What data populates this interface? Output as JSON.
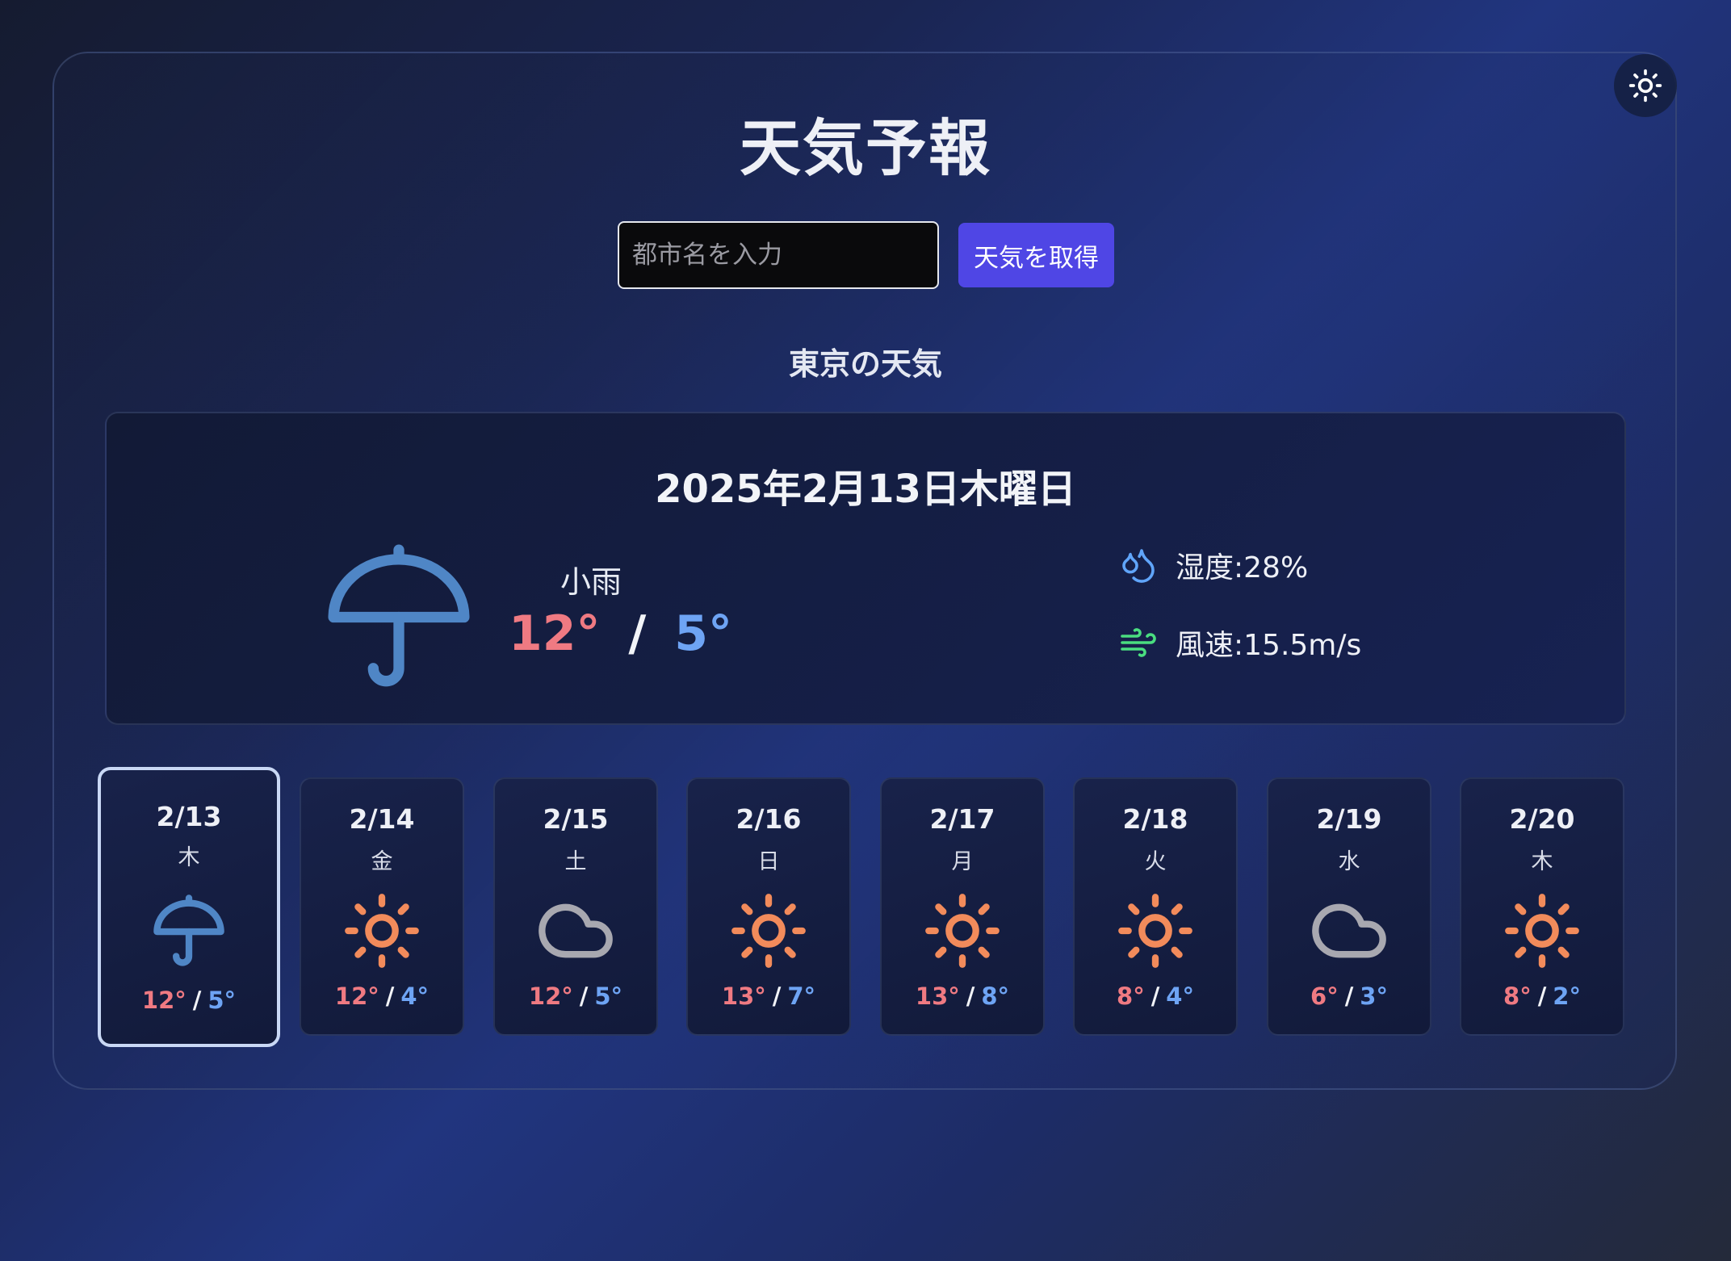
{
  "app": {
    "title": "天気予報"
  },
  "theme_toggle": {
    "icon": "sun-icon"
  },
  "search": {
    "placeholder": "都市名を入力",
    "value": "",
    "button_label": "天気を取得"
  },
  "location": {
    "heading": "東京の天気"
  },
  "current": {
    "date": "2025年2月13日木曜日",
    "condition": "小雨",
    "icon": "umbrella-icon",
    "high": "12°",
    "low": "5°",
    "separator": "/",
    "humidity": "湿度:28%",
    "wind": "風速:15.5m/s"
  },
  "colors": {
    "high_temp": "#ef7a82",
    "low_temp": "#6ea4f4",
    "umbrella": "#4f86c6",
    "sun": "#f28b5b",
    "cloud": "#a8a8b0",
    "wind_icon": "#4ade80",
    "humidity_icon": "#60a5fa",
    "button": "#4f46e5"
  },
  "forecast": [
    {
      "date": "2/13",
      "weekday": "木",
      "icon": "umbrella",
      "high": "12°",
      "low": "5°",
      "selected": true
    },
    {
      "date": "2/14",
      "weekday": "金",
      "icon": "sun",
      "high": "12°",
      "low": "4°",
      "selected": false
    },
    {
      "date": "2/15",
      "weekday": "土",
      "icon": "cloud",
      "high": "12°",
      "low": "5°",
      "selected": false
    },
    {
      "date": "2/16",
      "weekday": "日",
      "icon": "sun",
      "high": "13°",
      "low": "7°",
      "selected": false
    },
    {
      "date": "2/17",
      "weekday": "月",
      "icon": "sun",
      "high": "13°",
      "low": "8°",
      "selected": false
    },
    {
      "date": "2/18",
      "weekday": "火",
      "icon": "sun",
      "high": "8°",
      "low": "4°",
      "selected": false
    },
    {
      "date": "2/19",
      "weekday": "水",
      "icon": "cloud",
      "high": "6°",
      "low": "3°",
      "selected": false
    },
    {
      "date": "2/20",
      "weekday": "木",
      "icon": "sun",
      "high": "8°",
      "low": "2°",
      "selected": false
    }
  ]
}
